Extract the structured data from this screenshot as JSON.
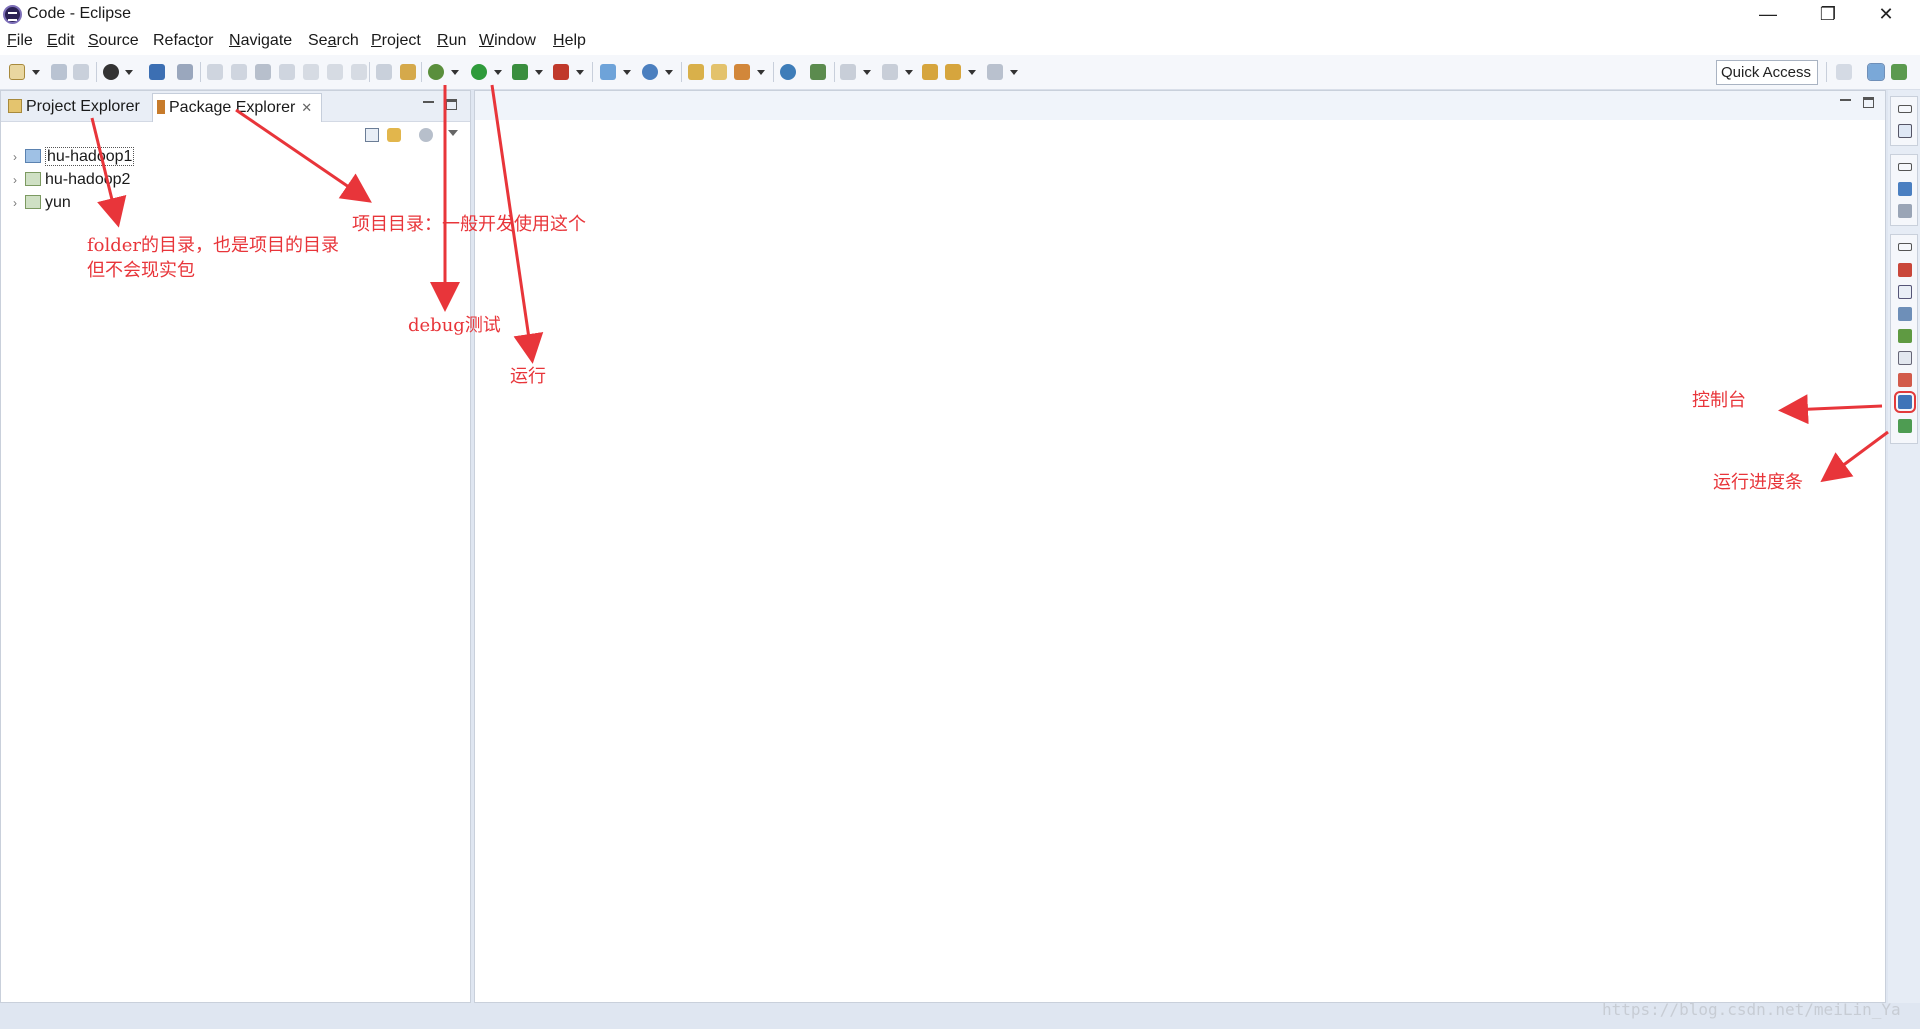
{
  "window": {
    "title": "Code - Eclipse",
    "controls": {
      "minimize": "—",
      "restore": "❐",
      "close": "✕"
    }
  },
  "menubar": {
    "items": [
      {
        "first": "F",
        "rest": "ile"
      },
      {
        "first": "E",
        "rest": "dit"
      },
      {
        "first": "S",
        "rest": "ource"
      },
      {
        "first": "",
        "rest": "Refac",
        "u2": "t",
        "rest2": "or"
      },
      {
        "first": "N",
        "rest": "avigate"
      },
      {
        "first": "",
        "rest": "Se",
        "u2": "a",
        "rest2": "rch"
      },
      {
        "first": "P",
        "rest": "roject"
      },
      {
        "first": "R",
        "rest": "un"
      },
      {
        "first": "W",
        "rest": "indow"
      },
      {
        "first": "H",
        "rest": "elp"
      }
    ]
  },
  "toolbar": {
    "quick_access": "Quick Access"
  },
  "left_panel": {
    "tabs": [
      {
        "label": "Project Explorer",
        "active": false
      },
      {
        "label": "Package Explorer",
        "active": true
      }
    ],
    "tree": [
      {
        "label": "hu-hadoop1",
        "selected": true
      },
      {
        "label": "hu-hadoop2",
        "selected": false
      },
      {
        "label": "yun",
        "selected": false
      }
    ]
  },
  "annotations": {
    "folder": "folder的目录，也是项目的目录",
    "folder2": "但不会现实包",
    "project_dir": "项目目录：一般开发使用这个",
    "debug": "debug测试",
    "run": "运行",
    "console": "控制台",
    "progress": "运行进度条"
  },
  "watermark": "https://blog.csdn.net/meiLin_Ya",
  "colors": {
    "annotation": "#e8353a",
    "background": "#dfe6f1"
  }
}
